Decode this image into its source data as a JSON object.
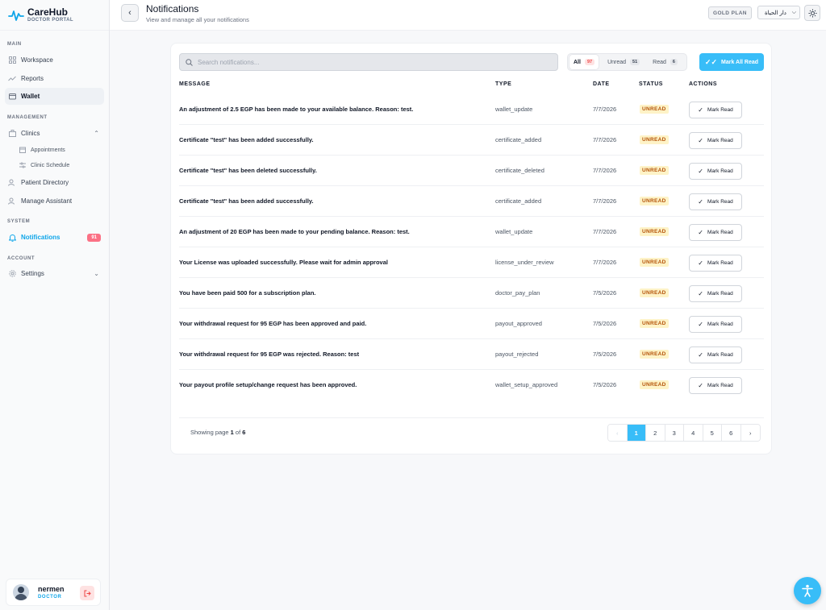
{
  "brand": {
    "name": "CareHub",
    "subtitle": "DOCTOR PORTAL"
  },
  "sidebar": {
    "sections": {
      "main": "MAIN",
      "management": "MANAGEMENT",
      "system": "SYSTEM",
      "account": "ACCOUNT"
    },
    "items": {
      "workspace": "Workspace",
      "reports": "Reports",
      "wallet": "Wallet",
      "clinics": "Clinics",
      "appointments": "Appointments",
      "clinic_schedule": "Clinic Schedule",
      "patient_directory": "Patient Directory",
      "manage_assistant": "Manage Assistant",
      "notifications": "Notifications",
      "notifications_badge": "91",
      "settings": "Settings"
    },
    "user": {
      "name": "nermen",
      "role": "DOCTOR"
    }
  },
  "header": {
    "title": "Notifications",
    "subtitle": "View and manage all your notifications",
    "plan": "GOLD PLAN",
    "language": "دار الحياة"
  },
  "toolbar": {
    "search_placeholder": "Search notifications...",
    "filters": [
      {
        "label": "All",
        "count": "97"
      },
      {
        "label": "Unread",
        "count": "51"
      },
      {
        "label": "Read",
        "count": "6"
      }
    ],
    "mark_all": "Mark All Read"
  },
  "table": {
    "headers": [
      "MESSAGE",
      "TYPE",
      "DATE",
      "STATUS",
      "ACTIONS"
    ],
    "action_label": "Mark Read",
    "rows": [
      {
        "message": "An adjustment of 2.5 EGP has been made to your available balance. Reason: test.",
        "type": "wallet_update",
        "date": "7/7/2026",
        "status": "UNREAD"
      },
      {
        "message": "Certificate \"test\" has been added successfully.",
        "type": "certificate_added",
        "date": "7/7/2026",
        "status": "UNREAD"
      },
      {
        "message": "Certificate \"test\" has been deleted successfully.",
        "type": "certificate_deleted",
        "date": "7/7/2026",
        "status": "UNREAD"
      },
      {
        "message": "Certificate \"test\" has been added successfully.",
        "type": "certificate_added",
        "date": "7/7/2026",
        "status": "UNREAD"
      },
      {
        "message": "An adjustment of 20 EGP has been made to your pending balance. Reason: test.",
        "type": "wallet_update",
        "date": "7/7/2026",
        "status": "UNREAD"
      },
      {
        "message": "Your License was uploaded successfully. Please wait for admin approval",
        "type": "license_under_review",
        "date": "7/7/2026",
        "status": "UNREAD"
      },
      {
        "message": "You have been paid 500 for a subscription plan.",
        "type": "doctor_pay_plan",
        "date": "7/5/2026",
        "status": "UNREAD"
      },
      {
        "message": "Your withdrawal request for 95 EGP has been approved and paid.",
        "type": "payout_approved",
        "date": "7/5/2026",
        "status": "UNREAD"
      },
      {
        "message": "Your withdrawal request for 95 EGP was rejected. Reason: test",
        "type": "payout_rejected",
        "date": "7/5/2026",
        "status": "UNREAD"
      },
      {
        "message": "Your payout profile setup/change request has been approved.",
        "type": "wallet_setup_approved",
        "date": "7/5/2026",
        "status": "UNREAD"
      }
    ]
  },
  "pagination": {
    "showing_prefix": "Showing page",
    "current": "1",
    "of_word": "of",
    "total": "6",
    "pages": [
      "1",
      "2",
      "3",
      "4",
      "5",
      "6"
    ]
  },
  "colors": {
    "accent": "#38bdf8",
    "badge": "#fb7185",
    "unread_bg": "#fef3c7",
    "unread_text": "#b45309"
  },
  "icons": [
    "pulse-logo-icon",
    "back-icon",
    "sun-icon",
    "search-icon",
    "check-icon",
    "logout-icon",
    "accessibility-icon"
  ]
}
